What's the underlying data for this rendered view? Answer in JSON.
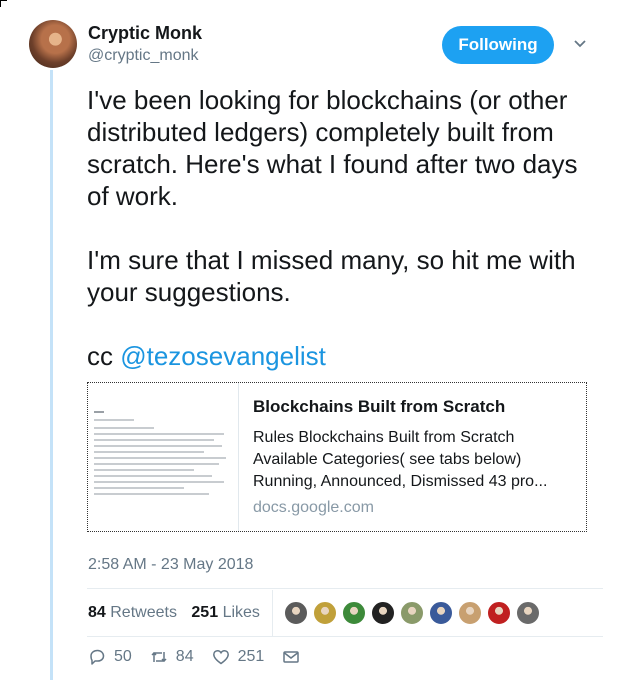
{
  "author": {
    "display_name": "Cryptic Monk",
    "handle": "@cryptic_monk"
  },
  "follow_button": {
    "label": "Following"
  },
  "tweet": {
    "paragraphs": [
      "I've been looking for blockchains (or other distributed ledgers) completely built from scratch. Here's what I found after two days of work.",
      "I'm sure that I missed many, so hit me with your suggestions."
    ],
    "cc_prefix": "cc",
    "mention": "@tezosevangelist"
  },
  "card": {
    "title": "Blockchains Built from Scratch",
    "description": "Rules Blockchains Built from Scratch Available Categories( see tabs below) Running, Announced, Dismissed 43 pro...",
    "domain": "docs.google.com"
  },
  "timestamp": "2:58 AM - 23 May 2018",
  "stats": {
    "retweets_count": "84",
    "retweets_label": "Retweets",
    "likes_count": "251",
    "likes_label": "Likes"
  },
  "likers": [
    "#5b5b5b",
    "#c0a03a",
    "#3d8a3a",
    "#222222",
    "#8a9a6a",
    "#3a5a9a",
    "#c8a070",
    "#c02020",
    "#6a6a6a"
  ],
  "actions": {
    "replies": "50",
    "retweets": "84",
    "likes": "251"
  },
  "colors": {
    "accent": "#1da1f2",
    "link": "#1b95e0",
    "muted": "#657786",
    "thread_line": "#c4e2f8"
  },
  "icons": [
    "chevron-down-icon",
    "reply-icon",
    "retweet-icon",
    "heart-icon",
    "mail-icon"
  ]
}
